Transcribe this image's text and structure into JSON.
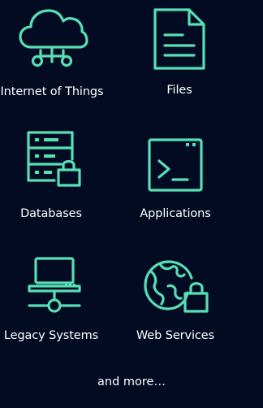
{
  "tiles": [
    {
      "label": "Internet of Things",
      "icon": "cloud-iot-icon"
    },
    {
      "label": "Files",
      "icon": "file-icon"
    },
    {
      "label": "Databases",
      "icon": "database-lock-icon"
    },
    {
      "label": "Applications",
      "icon": "terminal-window-icon"
    },
    {
      "label": "Legacy Systems",
      "icon": "laptop-network-icon"
    },
    {
      "label": "Web Services",
      "icon": "globe-lock-icon"
    }
  ],
  "footer": {
    "text": "and more…"
  },
  "colors": {
    "background": "#020b22",
    "accent": "#57dfb5",
    "text": "#ffffff"
  }
}
